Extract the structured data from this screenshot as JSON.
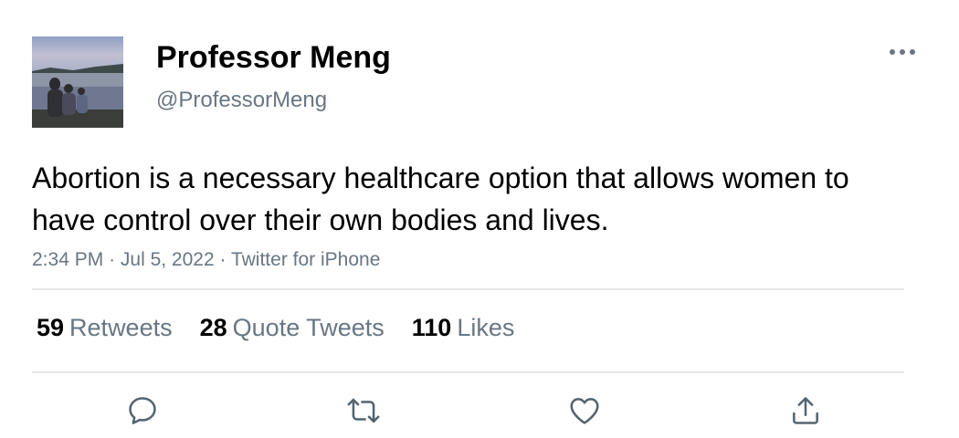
{
  "author": {
    "name": "Professor Meng",
    "handle": "@ProfessorMeng"
  },
  "tweet": {
    "text": "Abortion is a necessary healthcare option that allows women to have control over their own bodies and lives.",
    "time": "2:34 PM",
    "date": "Jul 5, 2022",
    "source": "Twitter for iPhone",
    "separator": "·"
  },
  "stats": {
    "retweets": {
      "count": "59",
      "label": "Retweets"
    },
    "quotes": {
      "count": "28",
      "label": "Quote Tweets"
    },
    "likes": {
      "count": "110",
      "label": "Likes"
    }
  },
  "icons": {
    "more": "more-horizontal-icon",
    "reply": "reply-icon",
    "retweet": "retweet-icon",
    "like": "heart-icon",
    "share": "share-icon"
  },
  "colors": {
    "secondary_text": "#687684",
    "divider": "#e4e7ea",
    "icon": "#536471"
  }
}
